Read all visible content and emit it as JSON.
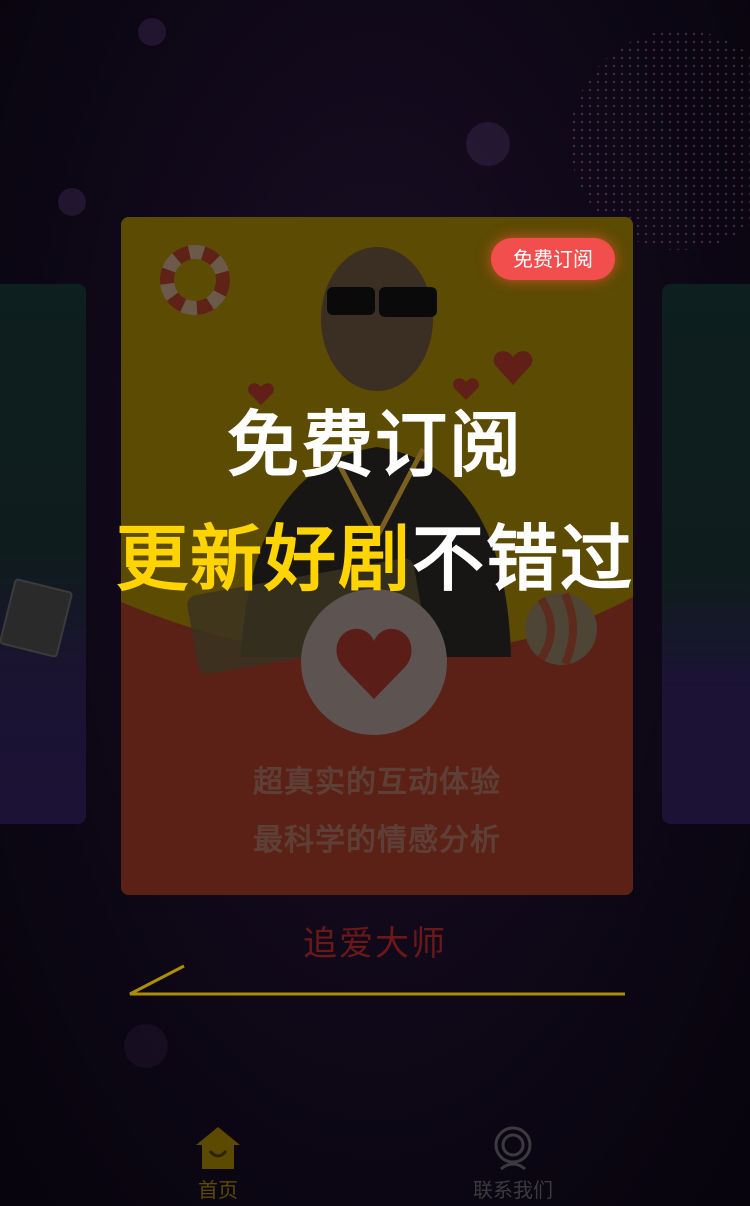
{
  "card": {
    "badge_label": "免费订阅",
    "tagline_1": "超真实的互动体验",
    "tagline_2": "最科学的情感分析"
  },
  "overlay": {
    "headline_1": "免费订阅",
    "headline_2_highlight": "更新好剧",
    "headline_2_rest": "不错过"
  },
  "brand_name": "追爱大师",
  "tabs": [
    {
      "label": "首页",
      "icon": "home-icon",
      "active": true
    },
    {
      "label": "联系我们",
      "icon": "contact-icon",
      "active": false
    }
  ],
  "colors": {
    "accent_yellow": "#ffd400",
    "badge_red": "#f24e4e",
    "background": "#0b0612"
  }
}
